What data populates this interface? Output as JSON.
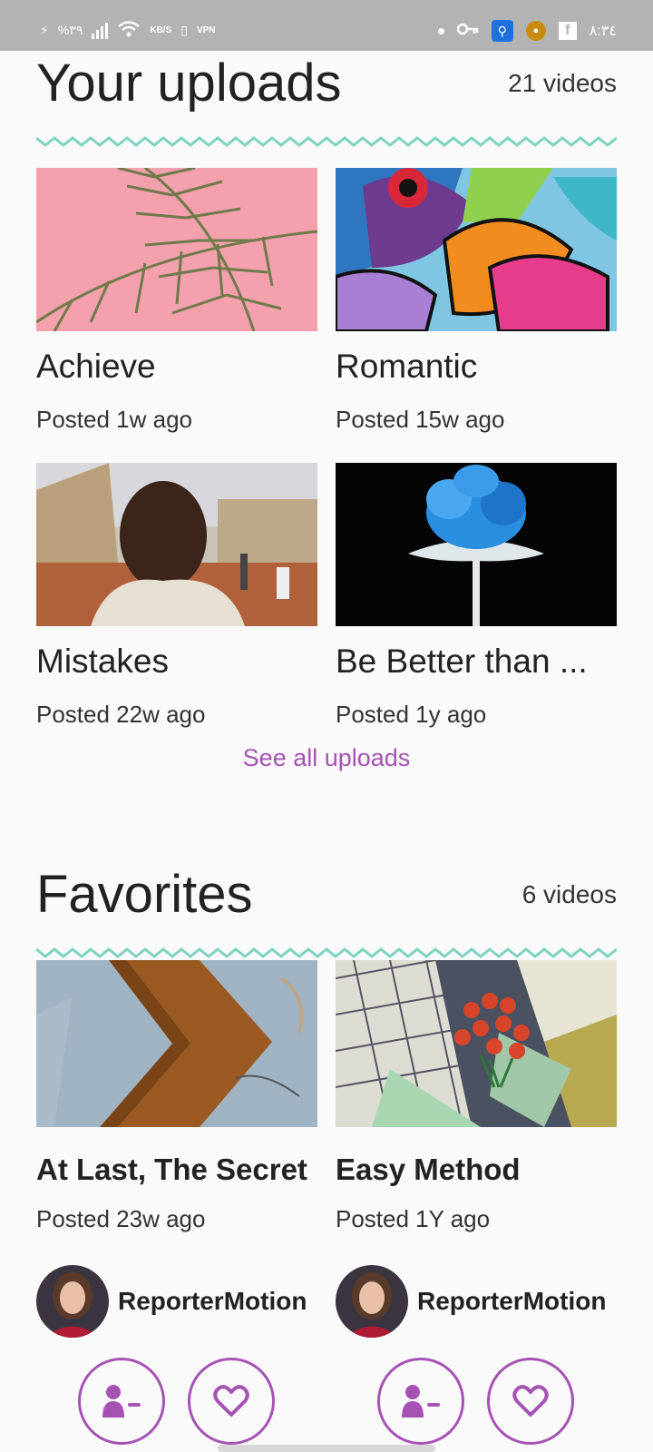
{
  "status_bar": {
    "left_text": "%٣٩",
    "speed_unit": "KB/S",
    "vpn_label": "VPN",
    "time": "٨:٣٤"
  },
  "uploads": {
    "title": "Your uploads",
    "count": "21 videos",
    "items": [
      {
        "title": "Achieve",
        "posted": "Posted 1w ago"
      },
      {
        "title": "Romantic",
        "posted": "Posted 15w ago"
      },
      {
        "title": "Mistakes",
        "posted": "Posted 22w ago"
      },
      {
        "title": "Be Better than ...",
        "posted": "Posted 1y ago"
      }
    ],
    "see_all": "See all uploads"
  },
  "favorites": {
    "title": "Favorites",
    "count": "6 videos",
    "items": [
      {
        "title": "At Last, The Secret",
        "posted": "Posted 23w ago",
        "author": "ReporterMotion"
      },
      {
        "title": "Easy Method",
        "posted": "Posted 1Y ago",
        "author": "ReporterMotion"
      }
    ]
  },
  "colors": {
    "accent": "#a552b4",
    "zigzag": "#7dd3c0",
    "status_bar": "#b3b3b3"
  },
  "icons": [
    "unfollow-icon",
    "heart-icon"
  ]
}
